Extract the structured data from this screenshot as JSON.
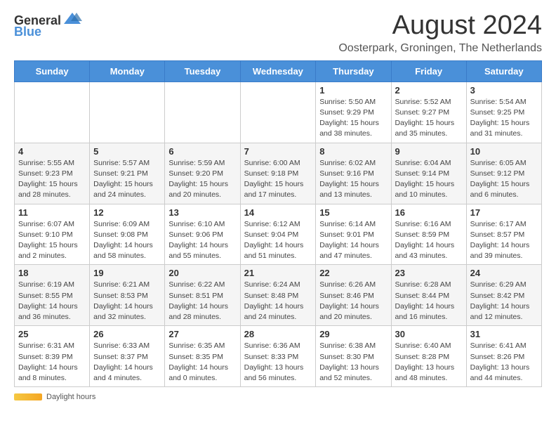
{
  "header": {
    "logo_general": "General",
    "logo_blue": "Blue",
    "month_title": "August 2024",
    "location": "Oosterpark, Groningen, The Netherlands"
  },
  "calendar": {
    "days_of_week": [
      "Sunday",
      "Monday",
      "Tuesday",
      "Wednesday",
      "Thursday",
      "Friday",
      "Saturday"
    ],
    "weeks": [
      [
        {
          "day": "",
          "info": ""
        },
        {
          "day": "",
          "info": ""
        },
        {
          "day": "",
          "info": ""
        },
        {
          "day": "",
          "info": ""
        },
        {
          "day": "1",
          "info": "Sunrise: 5:50 AM\nSunset: 9:29 PM\nDaylight: 15 hours and 38 minutes."
        },
        {
          "day": "2",
          "info": "Sunrise: 5:52 AM\nSunset: 9:27 PM\nDaylight: 15 hours and 35 minutes."
        },
        {
          "day": "3",
          "info": "Sunrise: 5:54 AM\nSunset: 9:25 PM\nDaylight: 15 hours and 31 minutes."
        }
      ],
      [
        {
          "day": "4",
          "info": "Sunrise: 5:55 AM\nSunset: 9:23 PM\nDaylight: 15 hours and 28 minutes."
        },
        {
          "day": "5",
          "info": "Sunrise: 5:57 AM\nSunset: 9:21 PM\nDaylight: 15 hours and 24 minutes."
        },
        {
          "day": "6",
          "info": "Sunrise: 5:59 AM\nSunset: 9:20 PM\nDaylight: 15 hours and 20 minutes."
        },
        {
          "day": "7",
          "info": "Sunrise: 6:00 AM\nSunset: 9:18 PM\nDaylight: 15 hours and 17 minutes."
        },
        {
          "day": "8",
          "info": "Sunrise: 6:02 AM\nSunset: 9:16 PM\nDaylight: 15 hours and 13 minutes."
        },
        {
          "day": "9",
          "info": "Sunrise: 6:04 AM\nSunset: 9:14 PM\nDaylight: 15 hours and 10 minutes."
        },
        {
          "day": "10",
          "info": "Sunrise: 6:05 AM\nSunset: 9:12 PM\nDaylight: 15 hours and 6 minutes."
        }
      ],
      [
        {
          "day": "11",
          "info": "Sunrise: 6:07 AM\nSunset: 9:10 PM\nDaylight: 15 hours and 2 minutes."
        },
        {
          "day": "12",
          "info": "Sunrise: 6:09 AM\nSunset: 9:08 PM\nDaylight: 14 hours and 58 minutes."
        },
        {
          "day": "13",
          "info": "Sunrise: 6:10 AM\nSunset: 9:06 PM\nDaylight: 14 hours and 55 minutes."
        },
        {
          "day": "14",
          "info": "Sunrise: 6:12 AM\nSunset: 9:04 PM\nDaylight: 14 hours and 51 minutes."
        },
        {
          "day": "15",
          "info": "Sunrise: 6:14 AM\nSunset: 9:01 PM\nDaylight: 14 hours and 47 minutes."
        },
        {
          "day": "16",
          "info": "Sunrise: 6:16 AM\nSunset: 8:59 PM\nDaylight: 14 hours and 43 minutes."
        },
        {
          "day": "17",
          "info": "Sunrise: 6:17 AM\nSunset: 8:57 PM\nDaylight: 14 hours and 39 minutes."
        }
      ],
      [
        {
          "day": "18",
          "info": "Sunrise: 6:19 AM\nSunset: 8:55 PM\nDaylight: 14 hours and 36 minutes."
        },
        {
          "day": "19",
          "info": "Sunrise: 6:21 AM\nSunset: 8:53 PM\nDaylight: 14 hours and 32 minutes."
        },
        {
          "day": "20",
          "info": "Sunrise: 6:22 AM\nSunset: 8:51 PM\nDaylight: 14 hours and 28 minutes."
        },
        {
          "day": "21",
          "info": "Sunrise: 6:24 AM\nSunset: 8:48 PM\nDaylight: 14 hours and 24 minutes."
        },
        {
          "day": "22",
          "info": "Sunrise: 6:26 AM\nSunset: 8:46 PM\nDaylight: 14 hours and 20 minutes."
        },
        {
          "day": "23",
          "info": "Sunrise: 6:28 AM\nSunset: 8:44 PM\nDaylight: 14 hours and 16 minutes."
        },
        {
          "day": "24",
          "info": "Sunrise: 6:29 AM\nSunset: 8:42 PM\nDaylight: 14 hours and 12 minutes."
        }
      ],
      [
        {
          "day": "25",
          "info": "Sunrise: 6:31 AM\nSunset: 8:39 PM\nDaylight: 14 hours and 8 minutes."
        },
        {
          "day": "26",
          "info": "Sunrise: 6:33 AM\nSunset: 8:37 PM\nDaylight: 14 hours and 4 minutes."
        },
        {
          "day": "27",
          "info": "Sunrise: 6:35 AM\nSunset: 8:35 PM\nDaylight: 14 hours and 0 minutes."
        },
        {
          "day": "28",
          "info": "Sunrise: 6:36 AM\nSunset: 8:33 PM\nDaylight: 13 hours and 56 minutes."
        },
        {
          "day": "29",
          "info": "Sunrise: 6:38 AM\nSunset: 8:30 PM\nDaylight: 13 hours and 52 minutes."
        },
        {
          "day": "30",
          "info": "Sunrise: 6:40 AM\nSunset: 8:28 PM\nDaylight: 13 hours and 48 minutes."
        },
        {
          "day": "31",
          "info": "Sunrise: 6:41 AM\nSunset: 8:26 PM\nDaylight: 13 hours and 44 minutes."
        }
      ]
    ]
  },
  "footer": {
    "daylight_label": "Daylight hours"
  }
}
